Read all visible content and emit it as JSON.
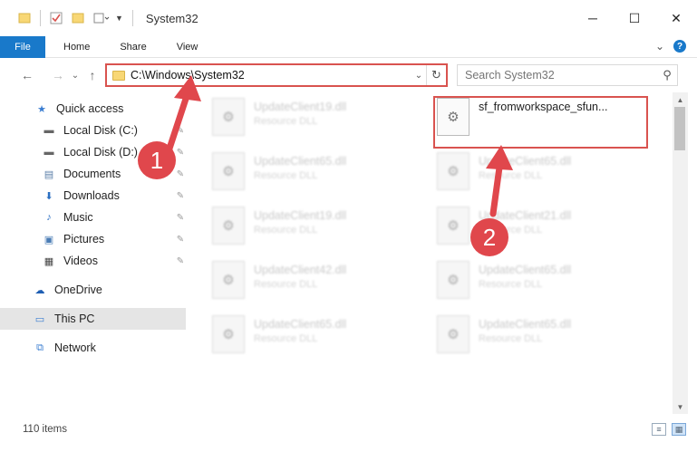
{
  "window": {
    "title": "System32",
    "minimize": "─",
    "maximize": "☐",
    "close": "✕"
  },
  "ribbon": {
    "tabs": [
      "File",
      "Home",
      "Share",
      "View"
    ],
    "collapse": "⌄",
    "help": "?"
  },
  "address": {
    "path": "C:\\Windows\\System32",
    "back": "←",
    "forward": "→",
    "recent": "⌄",
    "up": "↑",
    "dropdown": "⌄",
    "refresh": "↻"
  },
  "search": {
    "placeholder": "Search System32",
    "icon": "⚲"
  },
  "sidebar": {
    "items": [
      {
        "label": "Quick access",
        "icon": "star-icon",
        "glyph": "★",
        "color": "#3a7dd1",
        "pinned": false
      },
      {
        "label": "Local Disk (C:)",
        "icon": "drive-icon",
        "glyph": "▬",
        "color": "#666666",
        "pinned": true
      },
      {
        "label": "Local Disk (D:)",
        "icon": "drive-icon",
        "glyph": "▬",
        "color": "#666666",
        "pinned": true
      },
      {
        "label": "Documents",
        "icon": "documents-icon",
        "glyph": "▤",
        "color": "#5b7fa8",
        "pinned": true
      },
      {
        "label": "Downloads",
        "icon": "downloads-icon",
        "glyph": "⬇",
        "color": "#2b6fc2",
        "pinned": true
      },
      {
        "label": "Music",
        "icon": "music-icon",
        "glyph": "♪",
        "color": "#2b6fc2",
        "pinned": true
      },
      {
        "label": "Pictures",
        "icon": "pictures-icon",
        "glyph": "▣",
        "color": "#4a7cb5",
        "pinned": true
      },
      {
        "label": "Videos",
        "icon": "videos-icon",
        "glyph": "▦",
        "color": "#444444",
        "pinned": true
      },
      {
        "label": "OneDrive",
        "icon": "cloud-icon",
        "glyph": "☁",
        "color": "#1f5fb3",
        "pinned": false
      },
      {
        "label": "This PC",
        "icon": "computer-icon",
        "glyph": "▭",
        "color": "#3a7dd1",
        "pinned": false
      },
      {
        "label": "Network",
        "icon": "network-icon",
        "glyph": "⧉",
        "color": "#3a7dd1",
        "pinned": false
      }
    ],
    "pin_glyph": "✎"
  },
  "files": [
    {
      "name": "UpdateClient19.dll",
      "type": "Resource DLL"
    },
    {
      "name": "sf_fromworkspace_sfun...",
      "type": ""
    },
    {
      "name": "UpdateClient65.dll",
      "type": "Resource DLL"
    },
    {
      "name": "UpdateClient65.dll",
      "type": "Resource DLL"
    },
    {
      "name": "UpdateClient19.dll",
      "type": "Resource DLL"
    },
    {
      "name": "UpdateClient21.dll",
      "type": "Resource DLL"
    },
    {
      "name": "UpdateClient42.dll",
      "type": "Resource DLL"
    },
    {
      "name": "UpdateClient65.dll",
      "type": "Resource DLL"
    },
    {
      "name": "UpdateClient65.dll",
      "type": "Resource DLL"
    },
    {
      "name": "UpdateClient65.dll",
      "type": "Resource DLL"
    }
  ],
  "status": {
    "item_count": "110 items"
  },
  "annotations": {
    "badge1": "1",
    "badge2": "2",
    "accent": "#e0474c"
  }
}
